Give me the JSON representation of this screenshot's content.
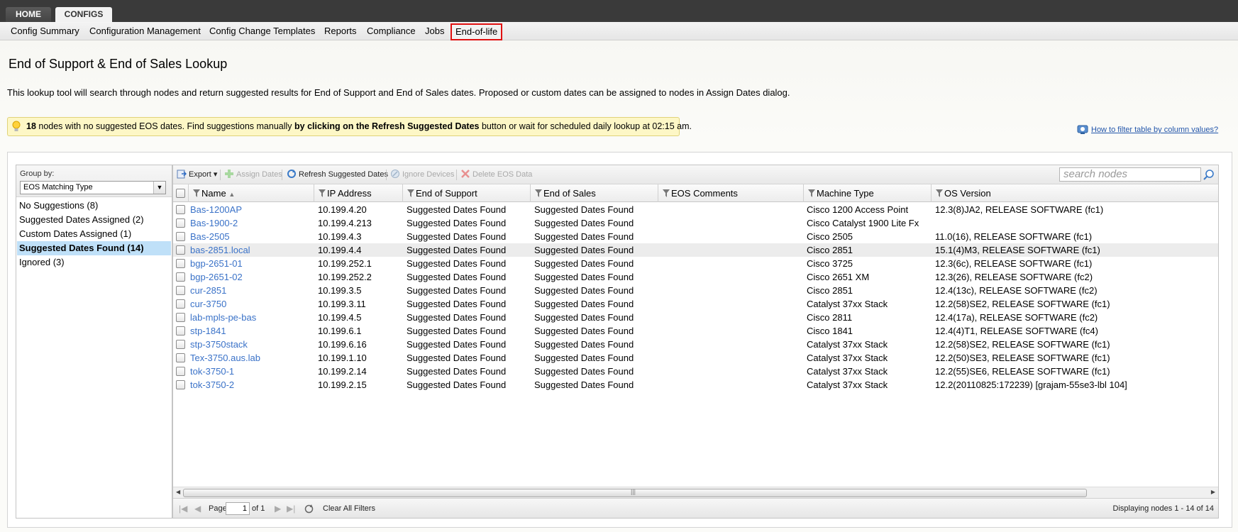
{
  "top_tabs": {
    "home": "HOME",
    "configs": "CONFIGS"
  },
  "subnav": [
    "Config Summary",
    "Configuration Management",
    "Config Change Templates",
    "Reports",
    "Compliance",
    "Jobs",
    "End-of-life"
  ],
  "page_title": "End of Support & End of Sales Lookup",
  "description": "This lookup tool will search through nodes and return suggested results for End of Support and End of Sales dates. Proposed or custom dates can be assigned to nodes in Assign Dates dialog.",
  "banner": {
    "count": "18",
    "text1": " nodes with no suggested EOS dates. Find suggestions manually ",
    "bold": "by clicking on the Refresh Suggested Dates",
    "text2": " button or wait for scheduled daily lookup at 02:15 am."
  },
  "help_link": "How to filter table by column values?",
  "group_by": {
    "label": "Group by:",
    "selected": "EOS Matching Type",
    "items": [
      "No Suggestions (8)",
      "Suggested Dates Assigned (2)",
      "Custom Dates Assigned (1)",
      "Suggested Dates Found (14)",
      "Ignored (3)"
    ],
    "selected_index": 3
  },
  "toolbar": {
    "export": "Export",
    "assign_dates": "Assign Dates",
    "refresh": "Refresh Suggested Dates",
    "ignore": "Ignore Devices",
    "delete": "Delete EOS Data",
    "search_placeholder": "search nodes"
  },
  "columns": [
    "Name",
    "IP Address",
    "End of Support",
    "End of Sales",
    "EOS Comments",
    "Machine Type",
    "OS Version"
  ],
  "rows": [
    {
      "name": "Bas-1200AP",
      "ip": "10.199.4.20",
      "eos": "Suggested Dates Found",
      "eosales": "Suggested Dates Found",
      "comments": "",
      "machine": "Cisco 1200 Access Point",
      "os": "12.3(8)JA2, RELEASE SOFTWARE (fc1)"
    },
    {
      "name": "Bas-1900-2",
      "ip": "10.199.4.213",
      "eos": "Suggested Dates Found",
      "eosales": "Suggested Dates Found",
      "comments": "",
      "machine": "Cisco Catalyst 1900 Lite Fx",
      "os": ""
    },
    {
      "name": "Bas-2505",
      "ip": "10.199.4.3",
      "eos": "Suggested Dates Found",
      "eosales": "Suggested Dates Found",
      "comments": "",
      "machine": "Cisco 2505",
      "os": "11.0(16), RELEASE SOFTWARE (fc1)"
    },
    {
      "name": "bas-2851.local",
      "ip": "10.199.4.4",
      "eos": "Suggested Dates Found",
      "eosales": "Suggested Dates Found",
      "comments": "",
      "machine": "Cisco 2851",
      "os": "15.1(4)M3, RELEASE SOFTWARE (fc1)"
    },
    {
      "name": "bgp-2651-01",
      "ip": "10.199.252.1",
      "eos": "Suggested Dates Found",
      "eosales": "Suggested Dates Found",
      "comments": "",
      "machine": "Cisco 3725",
      "os": "12.3(6c), RELEASE SOFTWARE (fc1)"
    },
    {
      "name": "bgp-2651-02",
      "ip": "10.199.252.2",
      "eos": "Suggested Dates Found",
      "eosales": "Suggested Dates Found",
      "comments": "",
      "machine": "Cisco 2651 XM",
      "os": "12.3(26), RELEASE SOFTWARE (fc2)"
    },
    {
      "name": "cur-2851",
      "ip": "10.199.3.5",
      "eos": "Suggested Dates Found",
      "eosales": "Suggested Dates Found",
      "comments": "",
      "machine": "Cisco 2851",
      "os": "12.4(13c), RELEASE SOFTWARE (fc2)"
    },
    {
      "name": "cur-3750",
      "ip": "10.199.3.11",
      "eos": "Suggested Dates Found",
      "eosales": "Suggested Dates Found",
      "comments": "",
      "machine": "Catalyst 37xx Stack",
      "os": "12.2(58)SE2, RELEASE SOFTWARE (fc1)"
    },
    {
      "name": "lab-mpls-pe-bas",
      "ip": "10.199.4.5",
      "eos": "Suggested Dates Found",
      "eosales": "Suggested Dates Found",
      "comments": "",
      "machine": "Cisco 2811",
      "os": "12.4(17a), RELEASE SOFTWARE (fc2)"
    },
    {
      "name": "stp-1841",
      "ip": "10.199.6.1",
      "eos": "Suggested Dates Found",
      "eosales": "Suggested Dates Found",
      "comments": "",
      "machine": "Cisco 1841",
      "os": "12.4(4)T1, RELEASE SOFTWARE (fc4)"
    },
    {
      "name": "stp-3750stack",
      "ip": "10.199.6.16",
      "eos": "Suggested Dates Found",
      "eosales": "Suggested Dates Found",
      "comments": "",
      "machine": "Catalyst 37xx Stack",
      "os": "12.2(58)SE2, RELEASE SOFTWARE (fc1)"
    },
    {
      "name": "Tex-3750.aus.lab",
      "ip": "10.199.1.10",
      "eos": "Suggested Dates Found",
      "eosales": "Suggested Dates Found",
      "comments": "",
      "machine": "Catalyst 37xx Stack",
      "os": "12.2(50)SE3, RELEASE SOFTWARE (fc1)"
    },
    {
      "name": "tok-3750-1",
      "ip": "10.199.2.14",
      "eos": "Suggested Dates Found",
      "eosales": "Suggested Dates Found",
      "comments": "",
      "machine": "Catalyst 37xx Stack",
      "os": "12.2(55)SE6, RELEASE SOFTWARE (fc1)"
    },
    {
      "name": "tok-3750-2",
      "ip": "10.199.2.15",
      "eos": "Suggested Dates Found",
      "eosales": "Suggested Dates Found",
      "comments": "",
      "machine": "Catalyst 37xx Stack",
      "os": "12.2(20110825:172239) [grajam-55se3-lbl 104]"
    }
  ],
  "highlighted_row": 3,
  "pager": {
    "page_label": "Page",
    "page_value": "1",
    "of_label": "of 1",
    "clear_filters": "Clear All Filters",
    "display": "Displaying nodes 1 - 14 of 14"
  },
  "colors": {
    "accent_link": "#3a72c8",
    "active_outline": "#e01010",
    "selected_group": "#bfe0f8",
    "banner_bg": "#fdf7c6"
  }
}
